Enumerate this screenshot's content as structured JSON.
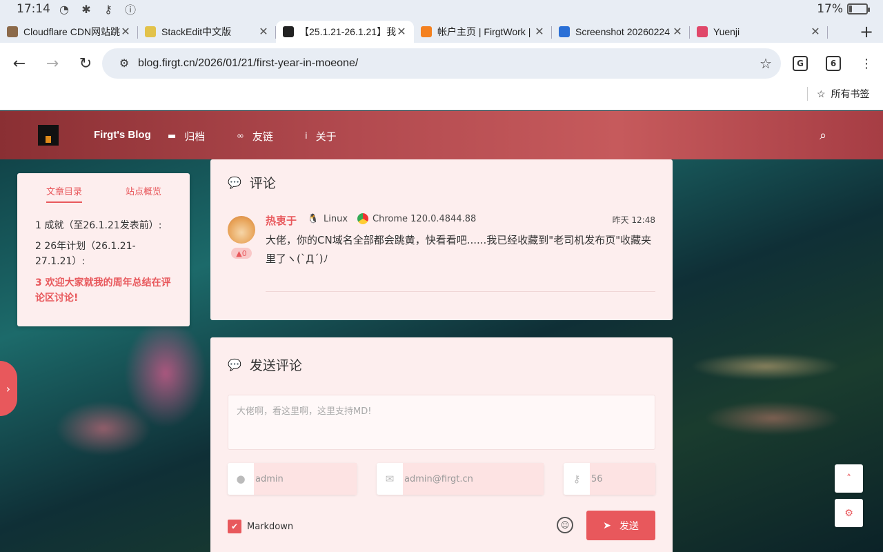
{
  "status": {
    "time": "17:14",
    "battery": "17%",
    "battery_level": 0.17
  },
  "tabs": [
    {
      "title": "Cloudflare CDN网站跳",
      "color": "#8c6a4a",
      "active": false
    },
    {
      "title": "StackEdit中文版",
      "color": "#e2c24a",
      "active": false
    },
    {
      "title": "【25.1.21-26.1.21】我",
      "color": "#222222",
      "active": true
    },
    {
      "title": "帐户主页 | FirgtWork | C",
      "color": "#f48120",
      "active": false
    },
    {
      "title": "Screenshot 20260224",
      "color": "#2a6fd6",
      "active": false
    },
    {
      "title": "Yuenji",
      "color": "#e0486a",
      "active": false
    }
  ],
  "omnibox": {
    "url": "blog.firgt.cn/2026/01/21/first-year-in-moeone/"
  },
  "toolbar": {
    "tab_count": "6"
  },
  "bookmarks": {
    "all_label": "所有书签"
  },
  "site": {
    "brand": "Firgt's Blog",
    "nav": [
      {
        "label": "归档",
        "icon": "archive-icon"
      },
      {
        "label": "友链",
        "icon": "link-icon"
      },
      {
        "label": "关于",
        "icon": "info-icon"
      }
    ]
  },
  "toc": {
    "tabs": [
      "文章目录",
      "站点概览"
    ],
    "items": [
      "1 成就（至26.1.21发表前）:",
      "2 26年计划（26.1.21-27.1.21）:",
      "3 欢迎大家就我的周年总结在评论区讨论!"
    ]
  },
  "comments": {
    "title": "评论",
    "items": [
      {
        "author": "热衷于",
        "os": "Linux",
        "browser": "Chrome 120.0.4844.88",
        "time": "昨天 12:48",
        "likes": "0",
        "text": "大佬，你的CN域名全部都会跳黄，快看看吧......我已经收藏到\"老司机发布页\"收藏夹里了ヽ(`Д´)ﾉ"
      }
    ]
  },
  "form": {
    "title": "发送评论",
    "placeholder": "大佬啊，看这里啊，这里支持MD!",
    "name": "admin",
    "email": "admin@firgt.cn",
    "code": "56",
    "markdown_label": "Markdown",
    "send_label": "发送"
  },
  "colors": {
    "accent": "#e8585c",
    "header": "#b24a4f",
    "card": "#fdeeee"
  }
}
